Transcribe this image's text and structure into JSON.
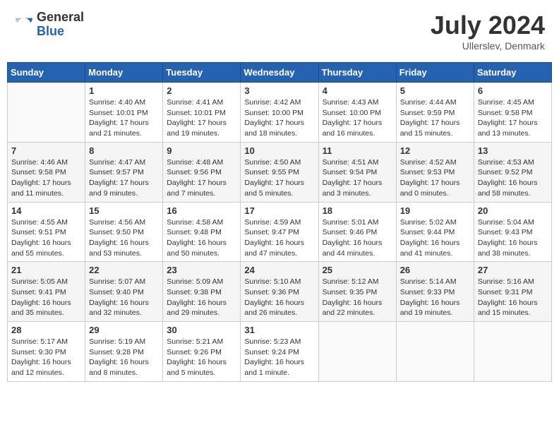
{
  "logo": {
    "general": "General",
    "blue": "Blue"
  },
  "title": "July 2024",
  "location": "Ullerslev, Denmark",
  "weekdays": [
    "Sunday",
    "Monday",
    "Tuesday",
    "Wednesday",
    "Thursday",
    "Friday",
    "Saturday"
  ],
  "weeks": [
    [
      {
        "day": "",
        "info": ""
      },
      {
        "day": "1",
        "info": "Sunrise: 4:40 AM\nSunset: 10:01 PM\nDaylight: 17 hours\nand 21 minutes."
      },
      {
        "day": "2",
        "info": "Sunrise: 4:41 AM\nSunset: 10:01 PM\nDaylight: 17 hours\nand 19 minutes."
      },
      {
        "day": "3",
        "info": "Sunrise: 4:42 AM\nSunset: 10:00 PM\nDaylight: 17 hours\nand 18 minutes."
      },
      {
        "day": "4",
        "info": "Sunrise: 4:43 AM\nSunset: 10:00 PM\nDaylight: 17 hours\nand 16 minutes."
      },
      {
        "day": "5",
        "info": "Sunrise: 4:44 AM\nSunset: 9:59 PM\nDaylight: 17 hours\nand 15 minutes."
      },
      {
        "day": "6",
        "info": "Sunrise: 4:45 AM\nSunset: 9:58 PM\nDaylight: 17 hours\nand 13 minutes."
      }
    ],
    [
      {
        "day": "7",
        "info": "Sunrise: 4:46 AM\nSunset: 9:58 PM\nDaylight: 17 hours\nand 11 minutes."
      },
      {
        "day": "8",
        "info": "Sunrise: 4:47 AM\nSunset: 9:57 PM\nDaylight: 17 hours\nand 9 minutes."
      },
      {
        "day": "9",
        "info": "Sunrise: 4:48 AM\nSunset: 9:56 PM\nDaylight: 17 hours\nand 7 minutes."
      },
      {
        "day": "10",
        "info": "Sunrise: 4:50 AM\nSunset: 9:55 PM\nDaylight: 17 hours\nand 5 minutes."
      },
      {
        "day": "11",
        "info": "Sunrise: 4:51 AM\nSunset: 9:54 PM\nDaylight: 17 hours\nand 3 minutes."
      },
      {
        "day": "12",
        "info": "Sunrise: 4:52 AM\nSunset: 9:53 PM\nDaylight: 17 hours\nand 0 minutes."
      },
      {
        "day": "13",
        "info": "Sunrise: 4:53 AM\nSunset: 9:52 PM\nDaylight: 16 hours\nand 58 minutes."
      }
    ],
    [
      {
        "day": "14",
        "info": "Sunrise: 4:55 AM\nSunset: 9:51 PM\nDaylight: 16 hours\nand 55 minutes."
      },
      {
        "day": "15",
        "info": "Sunrise: 4:56 AM\nSunset: 9:50 PM\nDaylight: 16 hours\nand 53 minutes."
      },
      {
        "day": "16",
        "info": "Sunrise: 4:58 AM\nSunset: 9:48 PM\nDaylight: 16 hours\nand 50 minutes."
      },
      {
        "day": "17",
        "info": "Sunrise: 4:59 AM\nSunset: 9:47 PM\nDaylight: 16 hours\nand 47 minutes."
      },
      {
        "day": "18",
        "info": "Sunrise: 5:01 AM\nSunset: 9:46 PM\nDaylight: 16 hours\nand 44 minutes."
      },
      {
        "day": "19",
        "info": "Sunrise: 5:02 AM\nSunset: 9:44 PM\nDaylight: 16 hours\nand 41 minutes."
      },
      {
        "day": "20",
        "info": "Sunrise: 5:04 AM\nSunset: 9:43 PM\nDaylight: 16 hours\nand 38 minutes."
      }
    ],
    [
      {
        "day": "21",
        "info": "Sunrise: 5:05 AM\nSunset: 9:41 PM\nDaylight: 16 hours\nand 35 minutes."
      },
      {
        "day": "22",
        "info": "Sunrise: 5:07 AM\nSunset: 9:40 PM\nDaylight: 16 hours\nand 32 minutes."
      },
      {
        "day": "23",
        "info": "Sunrise: 5:09 AM\nSunset: 9:38 PM\nDaylight: 16 hours\nand 29 minutes."
      },
      {
        "day": "24",
        "info": "Sunrise: 5:10 AM\nSunset: 9:36 PM\nDaylight: 16 hours\nand 26 minutes."
      },
      {
        "day": "25",
        "info": "Sunrise: 5:12 AM\nSunset: 9:35 PM\nDaylight: 16 hours\nand 22 minutes."
      },
      {
        "day": "26",
        "info": "Sunrise: 5:14 AM\nSunset: 9:33 PM\nDaylight: 16 hours\nand 19 minutes."
      },
      {
        "day": "27",
        "info": "Sunrise: 5:16 AM\nSunset: 9:31 PM\nDaylight: 16 hours\nand 15 minutes."
      }
    ],
    [
      {
        "day": "28",
        "info": "Sunrise: 5:17 AM\nSunset: 9:30 PM\nDaylight: 16 hours\nand 12 minutes."
      },
      {
        "day": "29",
        "info": "Sunrise: 5:19 AM\nSunset: 9:28 PM\nDaylight: 16 hours\nand 8 minutes."
      },
      {
        "day": "30",
        "info": "Sunrise: 5:21 AM\nSunset: 9:26 PM\nDaylight: 16 hours\nand 5 minutes."
      },
      {
        "day": "31",
        "info": "Sunrise: 5:23 AM\nSunset: 9:24 PM\nDaylight: 16 hours\nand 1 minute."
      },
      {
        "day": "",
        "info": ""
      },
      {
        "day": "",
        "info": ""
      },
      {
        "day": "",
        "info": ""
      }
    ]
  ]
}
